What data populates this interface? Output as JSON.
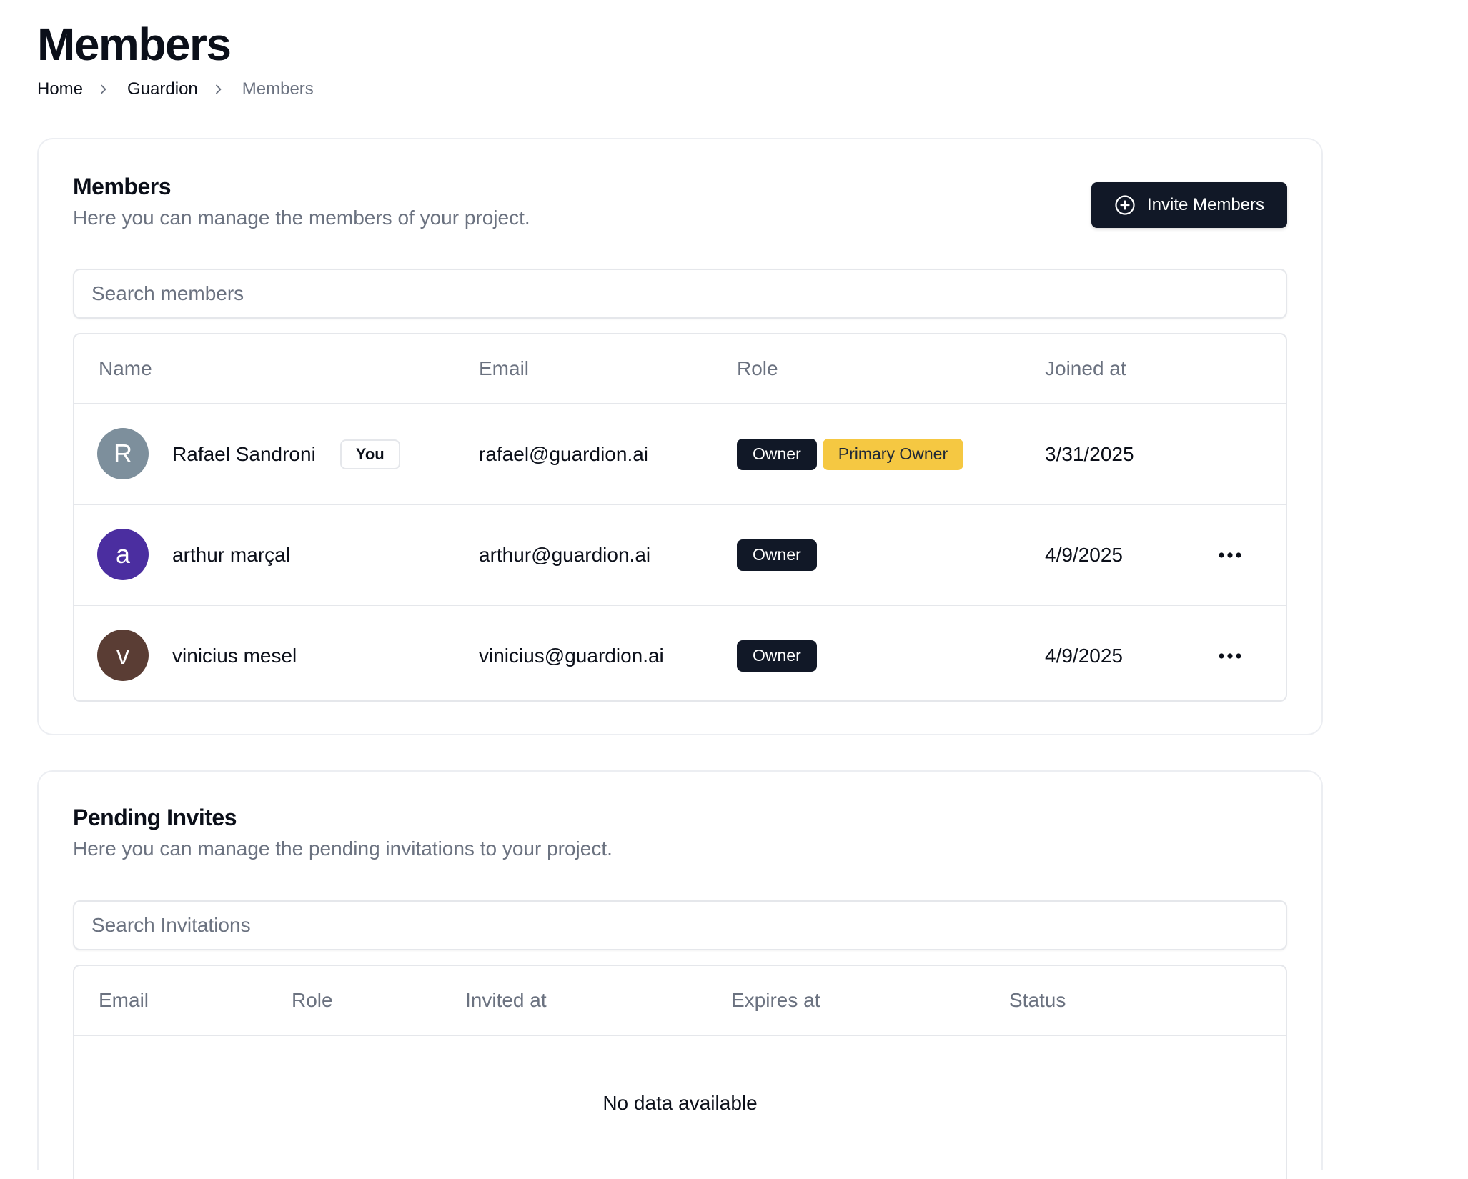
{
  "page": {
    "title": "Members"
  },
  "breadcrumb": {
    "items": [
      "Home",
      "Guardion",
      "Members"
    ]
  },
  "members_card": {
    "title": "Members",
    "description": "Here you can manage the members of your project.",
    "invite_button": "Invite Members",
    "invite_icon": "plus-circle-icon",
    "search_placeholder": "Search members",
    "columns": [
      "Name",
      "Email",
      "Role",
      "Joined at"
    ],
    "rows": [
      {
        "initial": "R",
        "avatar_color": "#7d8f9c",
        "name": "Rafael Sandroni",
        "you_label": "You",
        "email": "rafael@guardion.ai",
        "role": "Owner",
        "extra_role": "Primary Owner",
        "joined": "3/31/2025"
      },
      {
        "initial": "a",
        "avatar_color": "#4b2ea0",
        "name": "arthur marçal",
        "email": "arthur@guardion.ai",
        "role": "Owner",
        "joined": "4/9/2025"
      },
      {
        "initial": "v",
        "avatar_color": "#5a3d34",
        "name": "vinicius mesel",
        "email": "vinicius@guardion.ai",
        "role": "Owner",
        "joined": "4/9/2025"
      }
    ]
  },
  "invites_card": {
    "title": "Pending Invites",
    "description": "Here you can manage the pending invitations to your project.",
    "search_placeholder": "Search Invitations",
    "columns": [
      "Email",
      "Role",
      "Invited at",
      "Expires at",
      "Status"
    ],
    "empty_text": "No data available"
  },
  "colors": {
    "dark": "#111827",
    "primary_owner": "#f5c842",
    "muted": "#6b7280"
  }
}
